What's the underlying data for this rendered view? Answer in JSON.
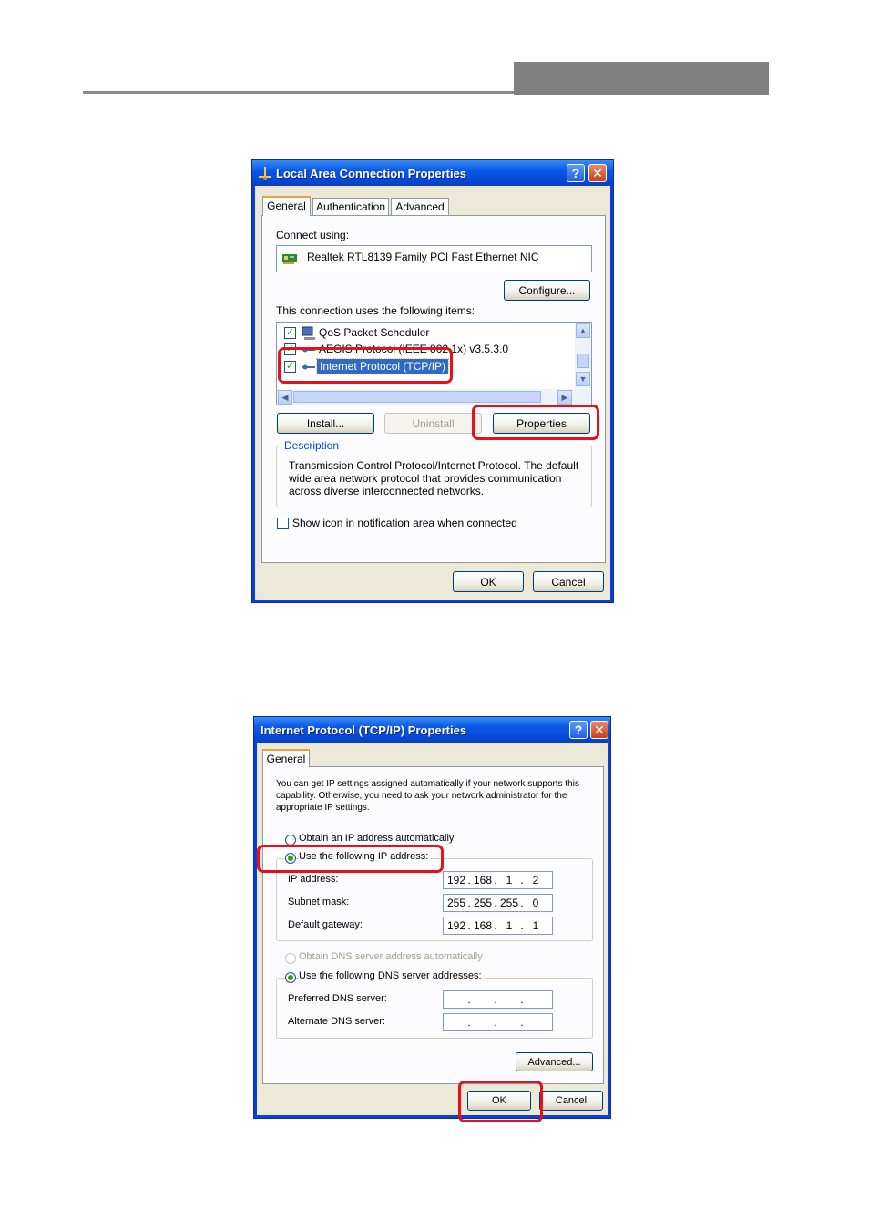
{
  "dialog1": {
    "title": "Local Area Connection Properties",
    "tabs": [
      "General",
      "Authentication",
      "Advanced"
    ],
    "connect_using_label": "Connect using:",
    "adapter_name": "Realtek RTL8139 Family PCI Fast Ethernet NIC",
    "configure_label": "Configure...",
    "items_label": "This connection uses the following items:",
    "items": [
      {
        "label": "QoS Packet Scheduler",
        "checked": true,
        "selected": false
      },
      {
        "label": "AEGIS Protocol (IEEE 802.1x) v3.5.3.0",
        "checked": true,
        "selected": false
      },
      {
        "label": "Internet Protocol (TCP/IP)",
        "checked": true,
        "selected": true
      }
    ],
    "install_label": "Install...",
    "uninstall_label": "Uninstall",
    "properties_label": "Properties",
    "description_legend": "Description",
    "description_text": "Transmission Control Protocol/Internet Protocol. The default wide area network protocol that provides communication across diverse interconnected networks.",
    "show_icon_label": "Show icon in notification area when connected",
    "ok_label": "OK",
    "cancel_label": "Cancel"
  },
  "dialog2": {
    "title": "Internet Protocol (TCP/IP) Properties",
    "tab": "General",
    "intro": "You can get IP settings assigned automatically if your network supports this capability. Otherwise, you need to ask your network administrator for the appropriate IP settings.",
    "obtain_ip_label": "Obtain an IP address automatically",
    "use_ip_label": "Use the following IP address:",
    "ip_label": "IP address:",
    "ip_value": [
      "192",
      "168",
      "1",
      "2"
    ],
    "subnet_label": "Subnet mask:",
    "subnet_value": [
      "255",
      "255",
      "255",
      "0"
    ],
    "gateway_label": "Default gateway:",
    "gateway_value": [
      "192",
      "168",
      "1",
      "1"
    ],
    "obtain_dns_label": "Obtain DNS server address automatically",
    "use_dns_label": "Use the following DNS server addresses:",
    "preferred_dns_label": "Preferred DNS server:",
    "alternate_dns_label": "Alternate DNS server:",
    "advanced_label": "Advanced...",
    "ok_label": "OK",
    "cancel_label": "Cancel"
  },
  "colors": {
    "highlight_box": "#e8101a",
    "title_bar": "#0a58e6",
    "selection": "#316ac5"
  }
}
